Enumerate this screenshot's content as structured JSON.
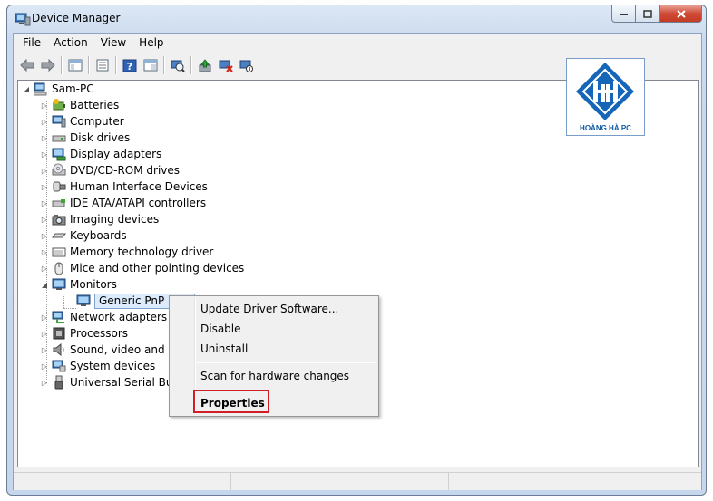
{
  "window": {
    "title": "Device Manager"
  },
  "menubar": {
    "items": [
      "File",
      "Action",
      "View",
      "Help"
    ]
  },
  "toolbar": {
    "buttons": [
      "back-icon",
      "forward-icon",
      "properties-grid-icon",
      "device-view-icon",
      "help-icon",
      "console-tree-icon",
      "scan-hardware-icon",
      "update-driver-icon",
      "uninstall-icon",
      "disable-icon"
    ]
  },
  "tree": {
    "root": "Sam-PC",
    "items": [
      {
        "label": "Batteries",
        "icon": "battery-icon",
        "expanded": false
      },
      {
        "label": "Computer",
        "icon": "computer-icon",
        "expanded": false
      },
      {
        "label": "Disk drives",
        "icon": "disk-drive-icon",
        "expanded": false
      },
      {
        "label": "Display adapters",
        "icon": "display-adapter-icon",
        "expanded": false
      },
      {
        "label": "DVD/CD-ROM drives",
        "icon": "dvd-drive-icon",
        "expanded": false
      },
      {
        "label": "Human Interface Devices",
        "icon": "hid-icon",
        "expanded": false
      },
      {
        "label": "IDE ATA/ATAPI controllers",
        "icon": "ide-controller-icon",
        "expanded": false
      },
      {
        "label": "Imaging devices",
        "icon": "camera-icon",
        "expanded": false
      },
      {
        "label": "Keyboards",
        "icon": "keyboard-icon",
        "expanded": false
      },
      {
        "label": "Memory technology driver",
        "icon": "memory-icon",
        "expanded": false
      },
      {
        "label": "Mice and other pointing devices",
        "icon": "mouse-icon",
        "expanded": false
      },
      {
        "label": "Monitors",
        "icon": "monitor-icon",
        "expanded": true
      },
      {
        "label": "Network adapters",
        "icon": "network-icon",
        "expanded": false
      },
      {
        "label": "Processors",
        "icon": "processor-icon",
        "expanded": false
      },
      {
        "label": "Sound, video and ga",
        "icon": "speaker-icon",
        "expanded": false
      },
      {
        "label": "System devices",
        "icon": "system-device-icon",
        "expanded": false
      },
      {
        "label": "Universal Serial Bus c",
        "icon": "usb-icon",
        "expanded": false
      }
    ],
    "selected_child": "Generic PnP Mon"
  },
  "context_menu": {
    "update_driver": "Update Driver Software...",
    "disable": "Disable",
    "uninstall": "Uninstall",
    "scan": "Scan for hardware changes",
    "properties": "Properties"
  },
  "watermark": {
    "text": "HOÀNG HÀ PC",
    "color": "#0d5aa7"
  },
  "colors": {
    "highlight": "#d21f26",
    "selection_bg": "#dcebfc"
  }
}
